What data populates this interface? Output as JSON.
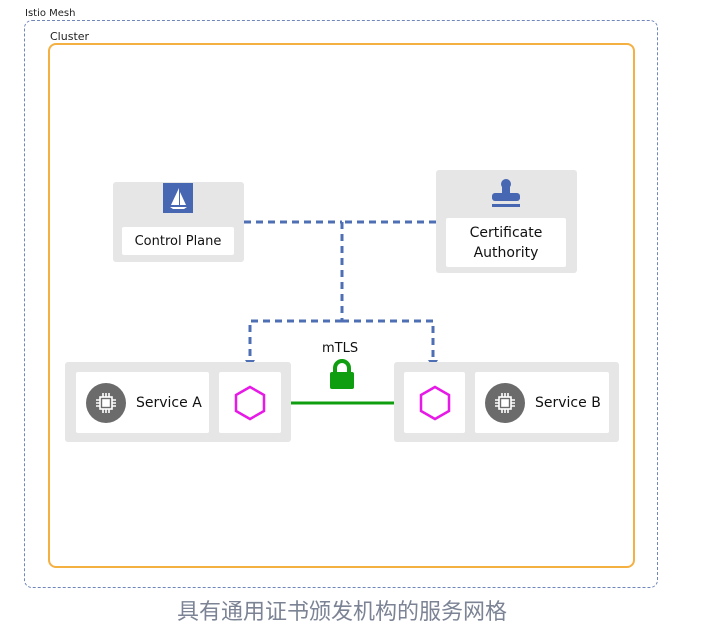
{
  "mesh": {
    "label": "Istio Mesh",
    "border_color": "#6f87bd"
  },
  "cluster": {
    "label": "Cluster",
    "border_color": "#f5b042"
  },
  "control_plane": {
    "label": "Control Plane",
    "icon": "istio-sailboat-icon",
    "icon_bg": "#4867b2"
  },
  "certificate_authority": {
    "label_line1": "Certificate",
    "label_line2": "Authority",
    "icon": "stamp-icon",
    "icon_color": "#4867b2"
  },
  "service_a": {
    "label": "Service A",
    "icon": "chip-icon",
    "proxy_icon": "hexagon-icon"
  },
  "service_b": {
    "label": "Service B",
    "icon": "chip-icon",
    "proxy_icon": "hexagon-icon"
  },
  "connection": {
    "label": "mTLS",
    "icon": "lock-icon",
    "color": "#0f9e0f"
  },
  "colors": {
    "dashed_link": "#4f6fb4",
    "proxy": "#e619e6",
    "service_icon_bg": "#6b6b6b"
  },
  "caption": "具有通用证书颁发机构的服务网格"
}
